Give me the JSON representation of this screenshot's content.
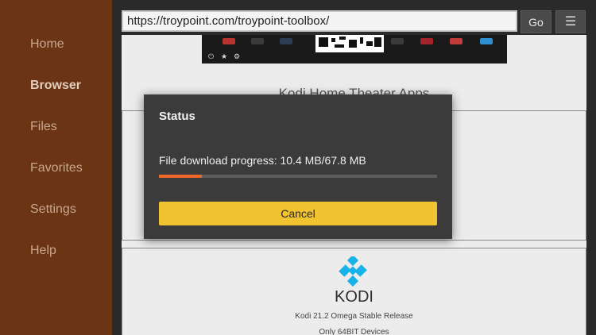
{
  "sidebar": {
    "items": [
      {
        "label": "Home",
        "active": false
      },
      {
        "label": "Browser",
        "active": true
      },
      {
        "label": "Files",
        "active": false
      },
      {
        "label": "Favorites",
        "active": false
      },
      {
        "label": "Settings",
        "active": false
      },
      {
        "label": "Help",
        "active": false
      }
    ]
  },
  "toolbar": {
    "url": "https://troypoint.com/troypoint-toolbox/",
    "go_label": "Go",
    "menu_icon": "hamburger-menu-icon"
  },
  "page": {
    "section_title": "Kodi Home Theater Apps",
    "kodi": {
      "wordmark": "KODI",
      "release": "Kodi 21.2 Omega Stable Release",
      "devices": "Only 64BIT Devices"
    }
  },
  "dialog": {
    "title": "Status",
    "progress_text": "File download progress: 10.4 MB/67.8 MB",
    "progress_fraction": 0.153,
    "cancel_label": "Cancel"
  },
  "colors": {
    "sidebar_bg": "#6a3415",
    "progress_accent": "#f0672a",
    "cancel_button": "#f1c330",
    "kodi_blue": "#17b2e7"
  }
}
